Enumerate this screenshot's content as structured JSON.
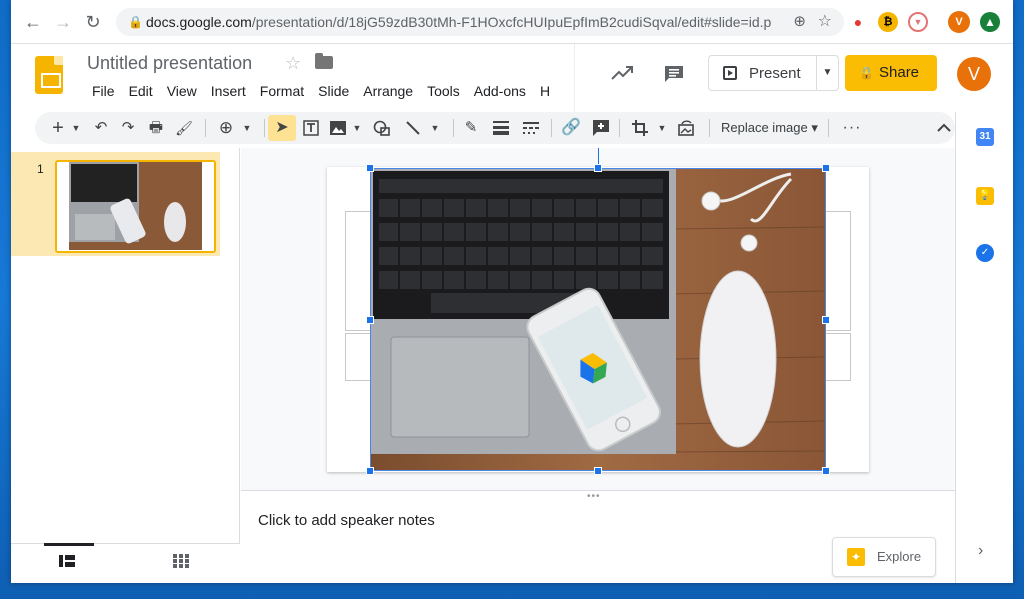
{
  "browser": {
    "url_host": "docs.google.com",
    "url_path": "/presentation/d/18jG59zdB30tMh-F1HOxcfcHUIpuEpfImB2cudiSqval/edit#slide=id.p",
    "back_icon": "←",
    "forward_icon": "→",
    "reload_icon": "↻",
    "profile_initial": "V"
  },
  "header": {
    "title": "Untitled presentation",
    "menu": [
      "File",
      "Edit",
      "View",
      "Insert",
      "Format",
      "Slide",
      "Arrange",
      "Tools",
      "Add-ons",
      "H"
    ],
    "present_label": "Present",
    "share_label": "Share",
    "avatar_initial": "V"
  },
  "toolbar": {
    "replace_image_label": "Replace image",
    "dropdown_glyph": "▾"
  },
  "filmstrip": {
    "slide_number": "1"
  },
  "notes": {
    "placeholder": "Click to add speaker notes",
    "explore_label": "Explore"
  },
  "side_panel": {
    "calendar_day": "31"
  },
  "colors": {
    "accent_blue": "#1a73e8",
    "share_yellow": "#fbbc04",
    "avatar_orange": "#e8710a",
    "selection_yellow": "#fce8b2"
  }
}
